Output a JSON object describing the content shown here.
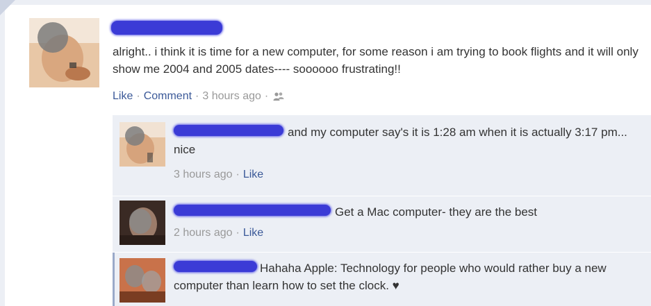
{
  "post": {
    "author_name": "",
    "text": "alright.. i think it is time for a new computer, for some reason i am trying to book flights and it will only show me 2004 and 2005 dates---- soooooo frustrating!!",
    "actions": {
      "like_label": "Like",
      "comment_label": "Comment",
      "timestamp": "3 hours ago",
      "audience_icon": "people-icon"
    }
  },
  "comments": [
    {
      "author_name": "",
      "text": "and my computer say's it is 1:28 am when it is actually 3:17 pm... nice",
      "timestamp": "3 hours ago",
      "like_label": "Like"
    },
    {
      "author_name": "",
      "text": "Get a Mac computer- they are the best",
      "timestamp": "2 hours ago",
      "like_label": "Like"
    },
    {
      "author_name": "",
      "text": "Hahaha Apple: Technology for people who would rather buy a new computer than learn how to set the clock. ♥",
      "timestamp": "",
      "like_label": ""
    }
  ],
  "colors": {
    "link": "#3b5998",
    "meta": "#999999",
    "comment_bg": "#eceff5",
    "name_scribble": "#3b3bd6"
  }
}
